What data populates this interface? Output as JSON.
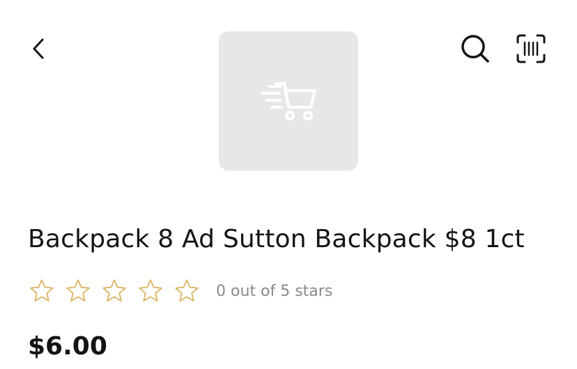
{
  "header": {
    "back_icon": "chevron-left-icon",
    "search_icon": "search-icon",
    "scan_icon": "barcode-scan-icon"
  },
  "product": {
    "image_placeholder_icon": "shopping-cart-icon",
    "title": "Backpack 8 Ad Sutton Backpack $8 1ct",
    "rating": {
      "value": 0,
      "max": 5,
      "text": "0 out of 5 stars",
      "star_color": "#d9b25c"
    },
    "price": "$6.00"
  }
}
